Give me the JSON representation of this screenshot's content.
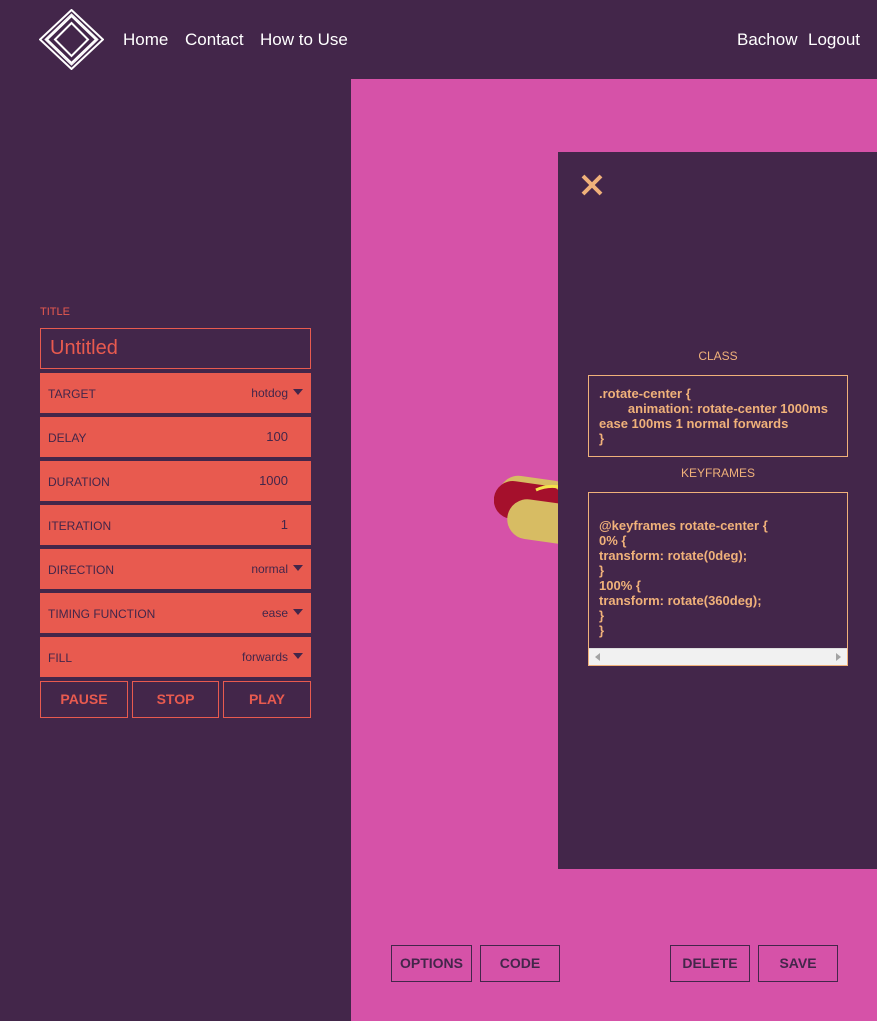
{
  "nav": {
    "links": [
      "Home",
      "Contact",
      "How to Use"
    ],
    "user": "Bachow",
    "logout": "Logout"
  },
  "form": {
    "title_label": "TITLE",
    "title_value": "Untitled",
    "fields": [
      {
        "label": "TARGET",
        "value": "hotdog"
      },
      {
        "label": "DELAY",
        "value": "100"
      },
      {
        "label": "DURATION",
        "value": "1000"
      },
      {
        "label": "ITERATION",
        "value": "1"
      },
      {
        "label": "DIRECTION",
        "value": "normal"
      },
      {
        "label": "TIMING FUNCTION",
        "value": "ease"
      },
      {
        "label": "FILL",
        "value": "forwards"
      }
    ],
    "controls": [
      "PAUSE",
      "STOP",
      "PLAY"
    ]
  },
  "code_panel": {
    "class_label": "CLASS",
    "class_code": ".rotate-center {\n        animation: rotate-center 1000ms\nease 100ms 1 normal forwards\n}",
    "keyframes_label": "KEYFRAMES",
    "keyframes_code": "@keyframes rotate-center {\n0% {\ntransform: rotate(0deg);\n}\n100% {\ntransform: rotate(360deg);\n}\n}"
  },
  "bottom": {
    "options": "OPTIONS",
    "code": "CODE",
    "delete": "DELETE",
    "save": "SAVE"
  },
  "colors": {
    "background": "#43264a",
    "stage": "#d652a8",
    "accent": "#e85a4f",
    "code_text": "#f0b17a"
  }
}
